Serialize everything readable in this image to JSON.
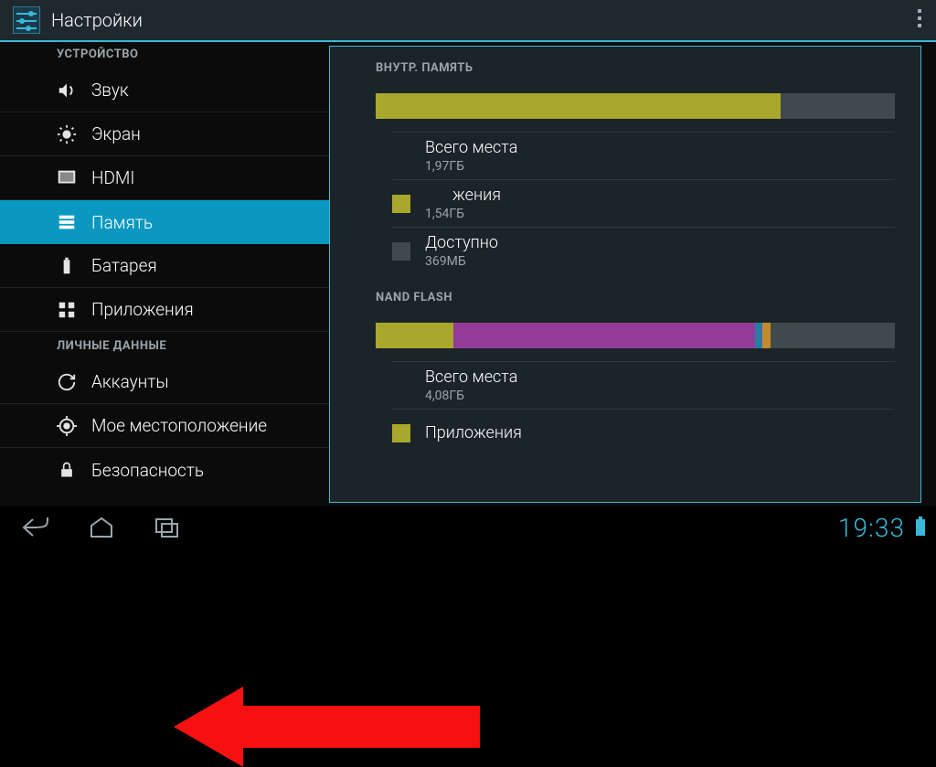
{
  "header": {
    "title": "Настройки"
  },
  "sidebar": {
    "section_device": "УСТРОЙСТВО",
    "section_personal": "ЛИЧНЫЕ ДАННЫЕ",
    "items": {
      "sound": "Звук",
      "display": "Экран",
      "hdmi": "HDMI",
      "storage": "Память",
      "battery": "Батарея",
      "apps": "Приложения",
      "accounts": "Аккаунты",
      "location": "Мое местоположение",
      "security": "Безопасность"
    }
  },
  "content": {
    "internal": {
      "title": "ВНУТР. ПАМЯТЬ",
      "bar": {
        "used_pct": 78,
        "color_used": "#a9a82c",
        "color_free": "#404a4e"
      },
      "total_label": "Всего места",
      "total_value": "1,97ГБ",
      "apps_suffix": "жения",
      "apps_value": "1,54ГБ",
      "apps_color": "#a9a82c",
      "avail_label": "Доступно",
      "avail_value": "369МБ",
      "avail_color": "#404a4e"
    },
    "nand": {
      "title": "NAND FLASH",
      "bar": [
        {
          "pct": 15,
          "color": "#a9a82c"
        },
        {
          "pct": 58,
          "color": "#933c97"
        },
        {
          "pct": 1.5,
          "color": "#2a7aa6"
        },
        {
          "pct": 1.5,
          "color": "#c58a2e"
        },
        {
          "pct": 24,
          "color": "#404a4e"
        }
      ],
      "total_label": "Всего места",
      "total_value": "4,08ГБ",
      "apps_label": "Приложения",
      "apps_color": "#a9a82c"
    }
  },
  "statusbar": {
    "time": "19:33"
  }
}
